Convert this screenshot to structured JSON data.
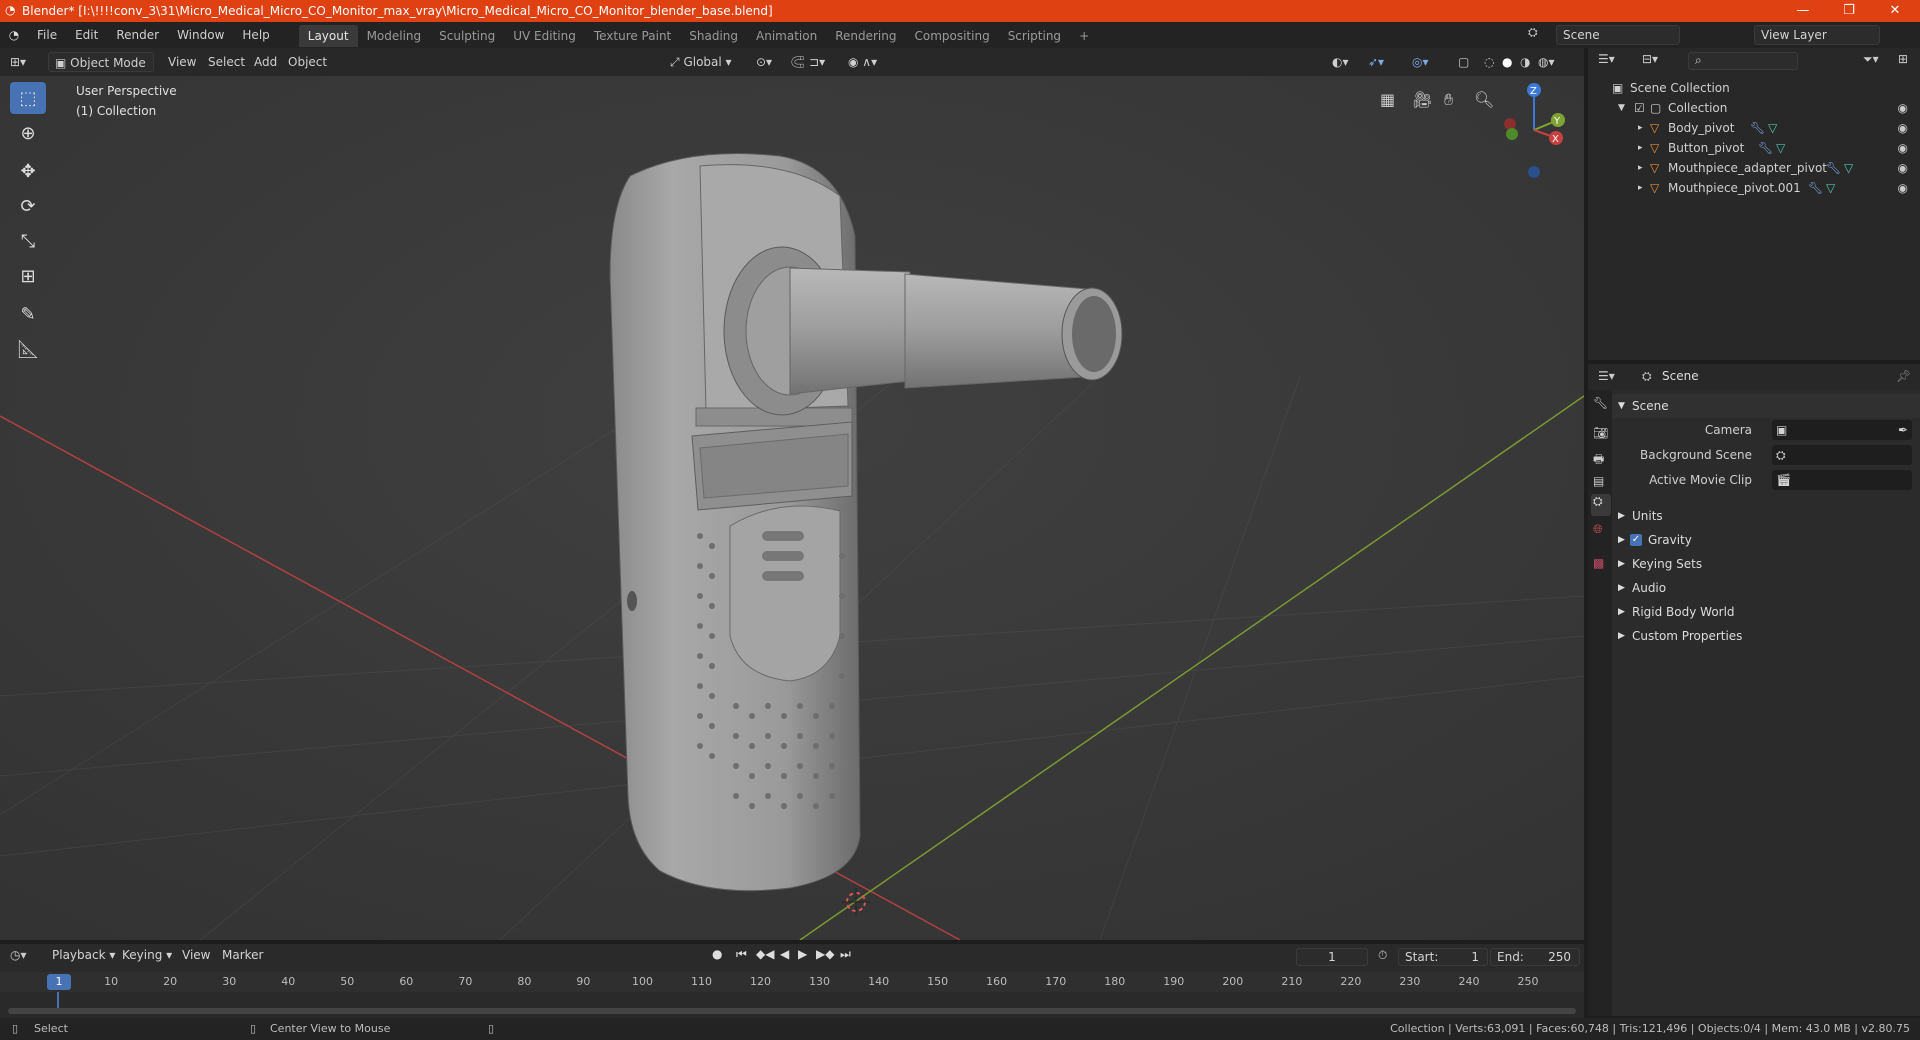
{
  "window": {
    "title": "Blender* [I:\\!!!!conv_3\\31\\Micro_Medical_Micro_CO_Monitor_max_vray\\Micro_Medical_Micro_CO_Monitor_blender_base.blend]",
    "minimize": "—",
    "restore": "❐",
    "close": "✕"
  },
  "menu": {
    "items": [
      "File",
      "Edit",
      "Render",
      "Window",
      "Help"
    ],
    "workspaces": [
      "Layout",
      "Modeling",
      "Sculpting",
      "UV Editing",
      "Texture Paint",
      "Shading",
      "Animation",
      "Rendering",
      "Compositing",
      "Scripting"
    ],
    "active_workspace": "Layout",
    "add_workspace": "+",
    "scene": "Scene",
    "view_layer": "View Layer"
  },
  "viewport_header": {
    "mode": "Object Mode",
    "menus": [
      "View",
      "Select",
      "Add",
      "Object"
    ],
    "transform_orientation": "Global"
  },
  "viewport": {
    "perspective_label": "User Perspective",
    "collection_label": "(1) Collection",
    "gizmo": {
      "x": "X",
      "y": "Y",
      "z": "Z"
    }
  },
  "outliner": {
    "root": "Scene Collection",
    "collection": "Collection",
    "objects": [
      "Body_pivot",
      "Button_pivot",
      "Mouthpiece_adapter_pivot",
      "Mouthpiece_pivot.001"
    ]
  },
  "properties": {
    "header": "Scene",
    "panel": "Scene",
    "fields": [
      {
        "label": "Camera",
        "value": ""
      },
      {
        "label": "Background Scene",
        "value": ""
      },
      {
        "label": "Active Movie Clip",
        "value": ""
      }
    ],
    "sections": [
      "Units",
      "Gravity",
      "Keying Sets",
      "Audio",
      "Rigid Body World",
      "Custom Properties"
    ],
    "gravity_checked": true
  },
  "timeline": {
    "menus": [
      "Playback",
      "Keying",
      "View",
      "Marker"
    ],
    "current_frame": "1",
    "start_label": "Start:",
    "start": "1",
    "end_label": "End:",
    "end": "250",
    "ticks": [
      "1",
      "10",
      "20",
      "30",
      "40",
      "50",
      "60",
      "70",
      "80",
      "90",
      "100",
      "110",
      "120",
      "130",
      "140",
      "150",
      "160",
      "170",
      "180",
      "190",
      "200",
      "210",
      "220",
      "230",
      "240",
      "250"
    ]
  },
  "statusbar": {
    "select": "Select",
    "center_view": "Center View to Mouse",
    "stats": "Collection | Verts:63,091 | Faces:60,748 | Tris:121,496 | Objects:0/4 | Mem: 43.0 MB | v2.80.75"
  },
  "colors": {
    "titlebar": "#e04112",
    "accent": "#4772b3",
    "x_axis": "#c8413f",
    "y_axis": "#7fa433",
    "z_axis": "#3c78d8"
  }
}
